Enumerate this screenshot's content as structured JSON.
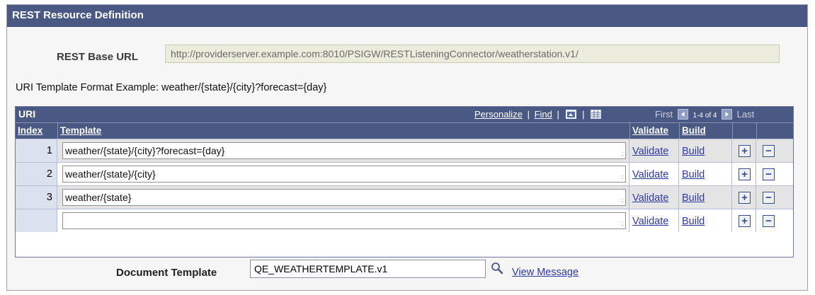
{
  "panel": {
    "title": "REST Resource Definition"
  },
  "base_url": {
    "label": "REST Base URL",
    "value": "http://providerserver.example.com:8010/PSIGW/RESTListeningConnector/weatherstation.v1/"
  },
  "example_text": "URI Template Format Example: weather/{state}/{city}?forecast={day}",
  "grid": {
    "title": "URI",
    "personalize": "Personalize",
    "find": "Find",
    "sep": "|",
    "pager": {
      "first": "First",
      "count": "1-4 of 4",
      "last": "Last"
    },
    "columns": {
      "index": "Index",
      "template": "Template",
      "validate": "Validate",
      "build": "Build"
    },
    "rows": [
      {
        "index": "1",
        "template": "weather/{state}/{city}?forecast={day}",
        "validate": "Validate",
        "build": "Build"
      },
      {
        "index": "2",
        "template": "weather/{state}/{city}",
        "validate": "Validate",
        "build": "Build"
      },
      {
        "index": "3",
        "template": "weather/{state}",
        "validate": "Validate",
        "build": "Build"
      },
      {
        "index": "",
        "template": "",
        "validate": "Validate",
        "build": "Build"
      }
    ],
    "add_symbol": "+",
    "delete_symbol": "−"
  },
  "document": {
    "label": "Document Template",
    "value": "QE_WEATHERTEMPLATE.v1",
    "view_link": "View Message"
  },
  "colors": {
    "header": "#4a5984",
    "link": "#2f39a3",
    "index_bg": "#dbe1ef",
    "readonly_bg": "#ececdc"
  },
  "icons": [
    "zoom-grid-icon",
    "download-spreadsheet-icon",
    "first-arrow-icon",
    "last-arrow-icon",
    "lookup-magnifier-icon",
    "add-row-icon",
    "delete-row-icon"
  ]
}
